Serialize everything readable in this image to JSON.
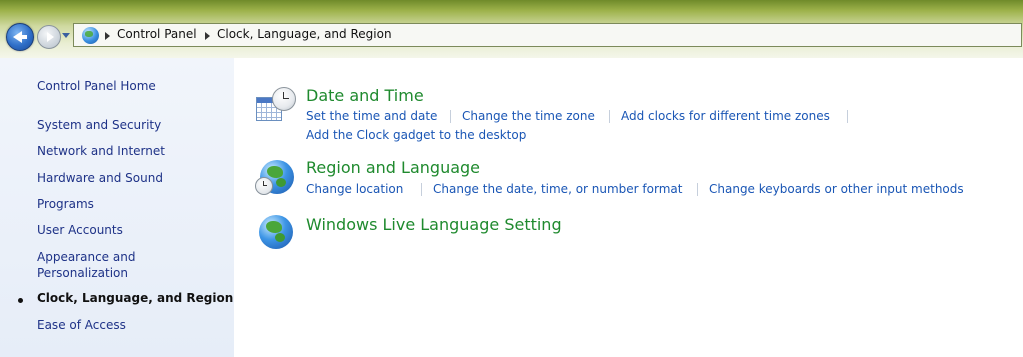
{
  "address_bar": {
    "crumbs": [
      "Control Panel",
      "Clock, Language, and Region"
    ]
  },
  "left_pane": {
    "items": [
      {
        "label": "Control Panel Home"
      },
      {
        "label": "System and Security"
      },
      {
        "label": "Network and Internet"
      },
      {
        "label": "Hardware and Sound"
      },
      {
        "label": "Programs"
      },
      {
        "label": "User Accounts"
      },
      {
        "label_line1": "Appearance and",
        "label_line2": "Personalization"
      },
      {
        "label": "Clock, Language, and Region",
        "current": true
      },
      {
        "label": "Ease of Access"
      }
    ]
  },
  "categories": [
    {
      "title": "Date and Time",
      "icon": "calendar-clock-icon",
      "links": [
        "Set the time and date",
        "Change the time zone",
        "Add clocks for different time zones",
        "Add the Clock gadget to the desktop"
      ]
    },
    {
      "title": "Region and Language",
      "icon": "globe-clock-icon",
      "links": [
        "Change location",
        "Change the date, time, or number format",
        "Change keyboards or other input methods"
      ]
    },
    {
      "title": "Windows Live Language Setting",
      "icon": "globe-icon",
      "links": []
    }
  ],
  "colors": {
    "link": "#1a56b5",
    "category_title": "#1f8a2e",
    "left_pane_link": "#1e3287"
  }
}
